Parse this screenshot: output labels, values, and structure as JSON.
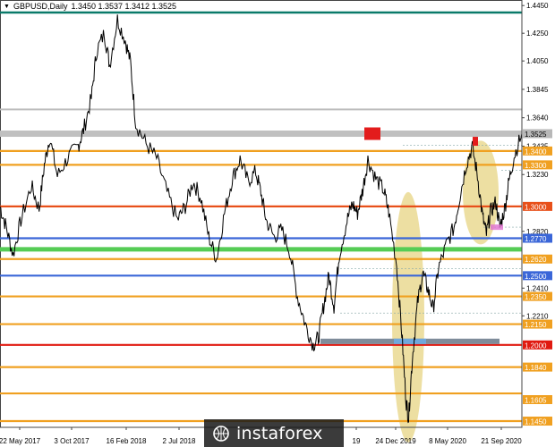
{
  "header": {
    "symbol": "GBPUSD,Daily",
    "ohlc": "1.3450 1.3537 1.3412 1.3525"
  },
  "watermark": {
    "text": "instaforex"
  },
  "chart_data": {
    "type": "line",
    "title": "GBPUSD,Daily",
    "ylim": [
      1.1405,
      1.449
    ],
    "grid": false,
    "ohlc_last": {
      "open": 1.345,
      "high": 1.3537,
      "low": 1.3412,
      "close": 1.3525
    },
    "x_tick_labels": [
      "22 May 2017",
      "3 Oct 2017",
      "16 Feb 2018",
      "2 Jul 2018",
      "19",
      "24 Dec 2019",
      "8 May 2020",
      "21 Sep 2020"
    ],
    "y_tick_labels": [
      "1.4450",
      "1.4250",
      "1.4050",
      "1.3845",
      "1.3640",
      "1.3525",
      "1.3435",
      "1.3400",
      "1.3300",
      "1.3230",
      "1.3000",
      "1.2820",
      "1.2770",
      "1.2620",
      "1.2500",
      "1.2410",
      "1.2350",
      "1.2210",
      "1.2150",
      "1.2000",
      "1.1840",
      "1.1605",
      "1.1450"
    ],
    "price_path": [
      [
        0,
        1.3
      ],
      [
        0.012,
        1.285
      ],
      [
        0.025,
        1.265
      ],
      [
        0.04,
        1.29
      ],
      [
        0.06,
        1.315
      ],
      [
        0.075,
        1.298
      ],
      [
        0.085,
        1.33
      ],
      [
        0.095,
        1.35
      ],
      [
        0.11,
        1.322
      ],
      [
        0.13,
        1.335
      ],
      [
        0.15,
        1.344
      ],
      [
        0.16,
        1.355
      ],
      [
        0.175,
        1.378
      ],
      [
        0.185,
        1.412
      ],
      [
        0.2,
        1.425
      ],
      [
        0.21,
        1.402
      ],
      [
        0.225,
        1.435
      ],
      [
        0.24,
        1.42
      ],
      [
        0.25,
        1.404
      ],
      [
        0.26,
        1.36
      ],
      [
        0.28,
        1.345
      ],
      [
        0.3,
        1.335
      ],
      [
        0.32,
        1.31
      ],
      [
        0.34,
        1.29
      ],
      [
        0.355,
        1.3
      ],
      [
        0.37,
        1.318
      ],
      [
        0.385,
        1.306
      ],
      [
        0.4,
        1.278
      ],
      [
        0.415,
        1.262
      ],
      [
        0.43,
        1.295
      ],
      [
        0.445,
        1.32
      ],
      [
        0.46,
        1.334
      ],
      [
        0.475,
        1.318
      ],
      [
        0.49,
        1.325
      ],
      [
        0.5,
        1.31
      ],
      [
        0.51,
        1.29
      ],
      [
        0.525,
        1.278
      ],
      [
        0.54,
        1.283
      ],
      [
        0.555,
        1.268
      ],
      [
        0.57,
        1.235
      ],
      [
        0.585,
        1.215
      ],
      [
        0.6,
        1.2
      ],
      [
        0.61,
        1.205
      ],
      [
        0.62,
        1.228
      ],
      [
        0.63,
        1.25
      ],
      [
        0.64,
        1.228
      ],
      [
        0.65,
        1.265
      ],
      [
        0.665,
        1.29
      ],
      [
        0.675,
        1.302
      ],
      [
        0.685,
        1.295
      ],
      [
        0.695,
        1.312
      ],
      [
        0.705,
        1.334
      ],
      [
        0.72,
        1.32
      ],
      [
        0.735,
        1.312
      ],
      [
        0.745,
        1.296
      ],
      [
        0.76,
        1.258
      ],
      [
        0.77,
        1.208
      ],
      [
        0.778,
        1.16
      ],
      [
        0.783,
        1.147
      ],
      [
        0.79,
        1.19
      ],
      [
        0.8,
        1.23
      ],
      [
        0.81,
        1.252
      ],
      [
        0.82,
        1.24
      ],
      [
        0.83,
        1.226
      ],
      [
        0.84,
        1.255
      ],
      [
        0.855,
        1.272
      ],
      [
        0.87,
        1.285
      ],
      [
        0.88,
        1.305
      ],
      [
        0.893,
        1.33
      ],
      [
        0.905,
        1.343
      ],
      [
        0.915,
        1.322
      ],
      [
        0.925,
        1.292
      ],
      [
        0.932,
        1.28
      ],
      [
        0.94,
        1.296
      ],
      [
        0.95,
        1.303
      ],
      [
        0.958,
        1.285
      ],
      [
        0.968,
        1.3
      ],
      [
        0.975,
        1.318
      ],
      [
        0.985,
        1.336
      ],
      [
        1.0,
        1.3525
      ]
    ],
    "levels": [
      {
        "price": 1.44,
        "color": "#0a7a6a",
        "label": ""
      },
      {
        "price": 1.37,
        "color": "#b5b5b5",
        "label": ""
      },
      {
        "price": 1.3525,
        "color": "#b8b8b8",
        "label": "1.3525"
      },
      {
        "price": 1.34,
        "color": "#f0a020",
        "label": "1.3400"
      },
      {
        "price": 1.33,
        "color": "#f0a020",
        "label": "1.3300"
      },
      {
        "price": 1.3,
        "color": "#e8501a",
        "label": "1.3000"
      },
      {
        "price": 1.277,
        "color": "#3a66d8",
        "label": "1.2770"
      },
      {
        "price": 1.269,
        "color": "#55cc55",
        "label": ""
      },
      {
        "price": 1.262,
        "color": "#f0a020",
        "label": "1.2620"
      },
      {
        "price": 1.25,
        "color": "#3a66d8",
        "label": "1.2500"
      },
      {
        "price": 1.235,
        "color": "#f0a020",
        "label": "1.2350"
      },
      {
        "price": 1.215,
        "color": "#f0a020",
        "label": "1.2150"
      },
      {
        "price": 1.2,
        "color": "#e01a10",
        "label": "1.2000"
      },
      {
        "price": 1.184,
        "color": "#f0a020",
        "label": "1.1840"
      },
      {
        "price": 1.165,
        "color": "#f0a020",
        "label": "1.1605"
      },
      {
        "price": 1.145,
        "color": "#f0a020",
        "label": "1.1450"
      }
    ],
    "colors": {
      "price": "#000000",
      "ellipse": "#e6d27a",
      "accent": "#e31c1c",
      "band_blue": "#6fa8dc",
      "band_gray": "#7f8c9a"
    }
  }
}
